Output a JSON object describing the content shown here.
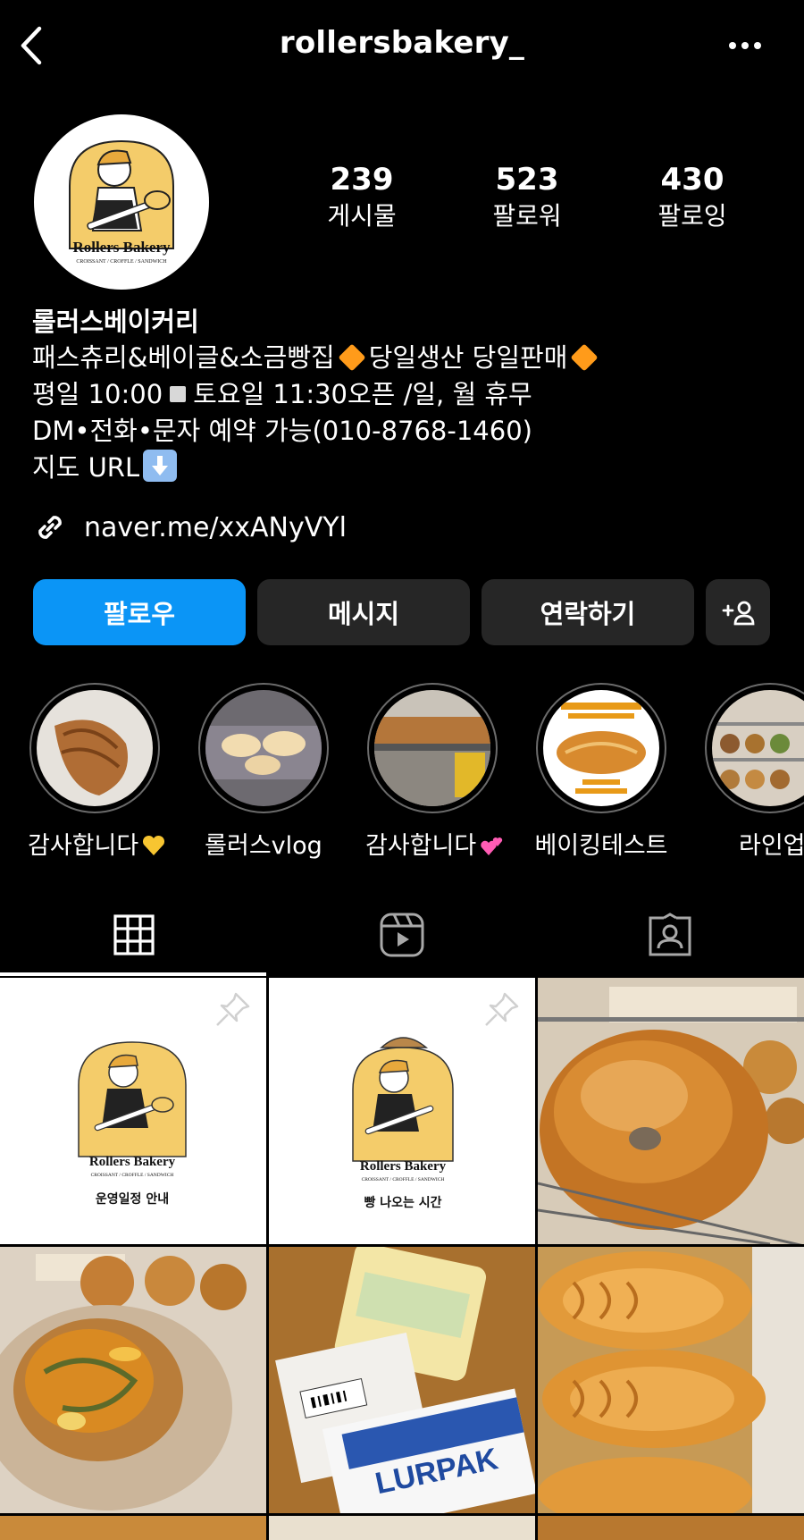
{
  "header": {
    "username": "rollersbakery_",
    "back_icon": "chevron-left-icon",
    "more_icon": "more-horizontal-icon"
  },
  "profile": {
    "avatar": {
      "brand": "Rollers Bakery",
      "tagline": "CROISSANT / CROFFLE / SANDWICH"
    },
    "stats": [
      {
        "value": "239",
        "label": "게시물"
      },
      {
        "value": "523",
        "label": "팔로워"
      },
      {
        "value": "430",
        "label": "팔로잉"
      }
    ],
    "name": "롤러스베이커리",
    "bio": {
      "line1_a": "패스츄리&베이글&소금빵집",
      "line1_b": "당일생산 당일판매",
      "line2_a": "평일 10:00",
      "line2_b": "토요일 11:30오픈 /일, 월 휴무",
      "line3": "DM•전화•문자 예약 가능(010-8768-1460)",
      "line4": "지도 URL"
    },
    "link": "naver.me/xxANyVYl"
  },
  "actions": {
    "follow": "팔로우",
    "message": "메시지",
    "contact": "연락하기",
    "add_person_icon": "add-person-icon"
  },
  "highlights": [
    {
      "label": "감사합니다",
      "emoji": "yellow-heart"
    },
    {
      "label": "롤러스vlog"
    },
    {
      "label": "감사합니다",
      "emoji": "two-hearts"
    },
    {
      "label": "베이킹테스트"
    },
    {
      "label": "라인업"
    }
  ],
  "tabs": [
    {
      "name": "grid-icon",
      "active": true
    },
    {
      "name": "reels-icon",
      "active": false
    },
    {
      "name": "tagged-icon",
      "active": false
    }
  ],
  "posts": [
    {
      "kind": "logo",
      "caption": "운영일정 안내",
      "pinned": true
    },
    {
      "kind": "logo",
      "caption": "빵 나오는 시간",
      "pinned": true
    },
    {
      "kind": "photo-bagel",
      "pinned": false
    },
    {
      "kind": "photo-pumpkin-bread",
      "pinned": false
    },
    {
      "kind": "photo-butter",
      "brand": "LURPAK",
      "pinned": false
    },
    {
      "kind": "photo-taiyaki",
      "pinned": false
    }
  ],
  "colors": {
    "background": "#000000",
    "follow_button": "#0b95f6",
    "secondary_button": "#262626",
    "logo_yellow": "#f4cc6a"
  }
}
